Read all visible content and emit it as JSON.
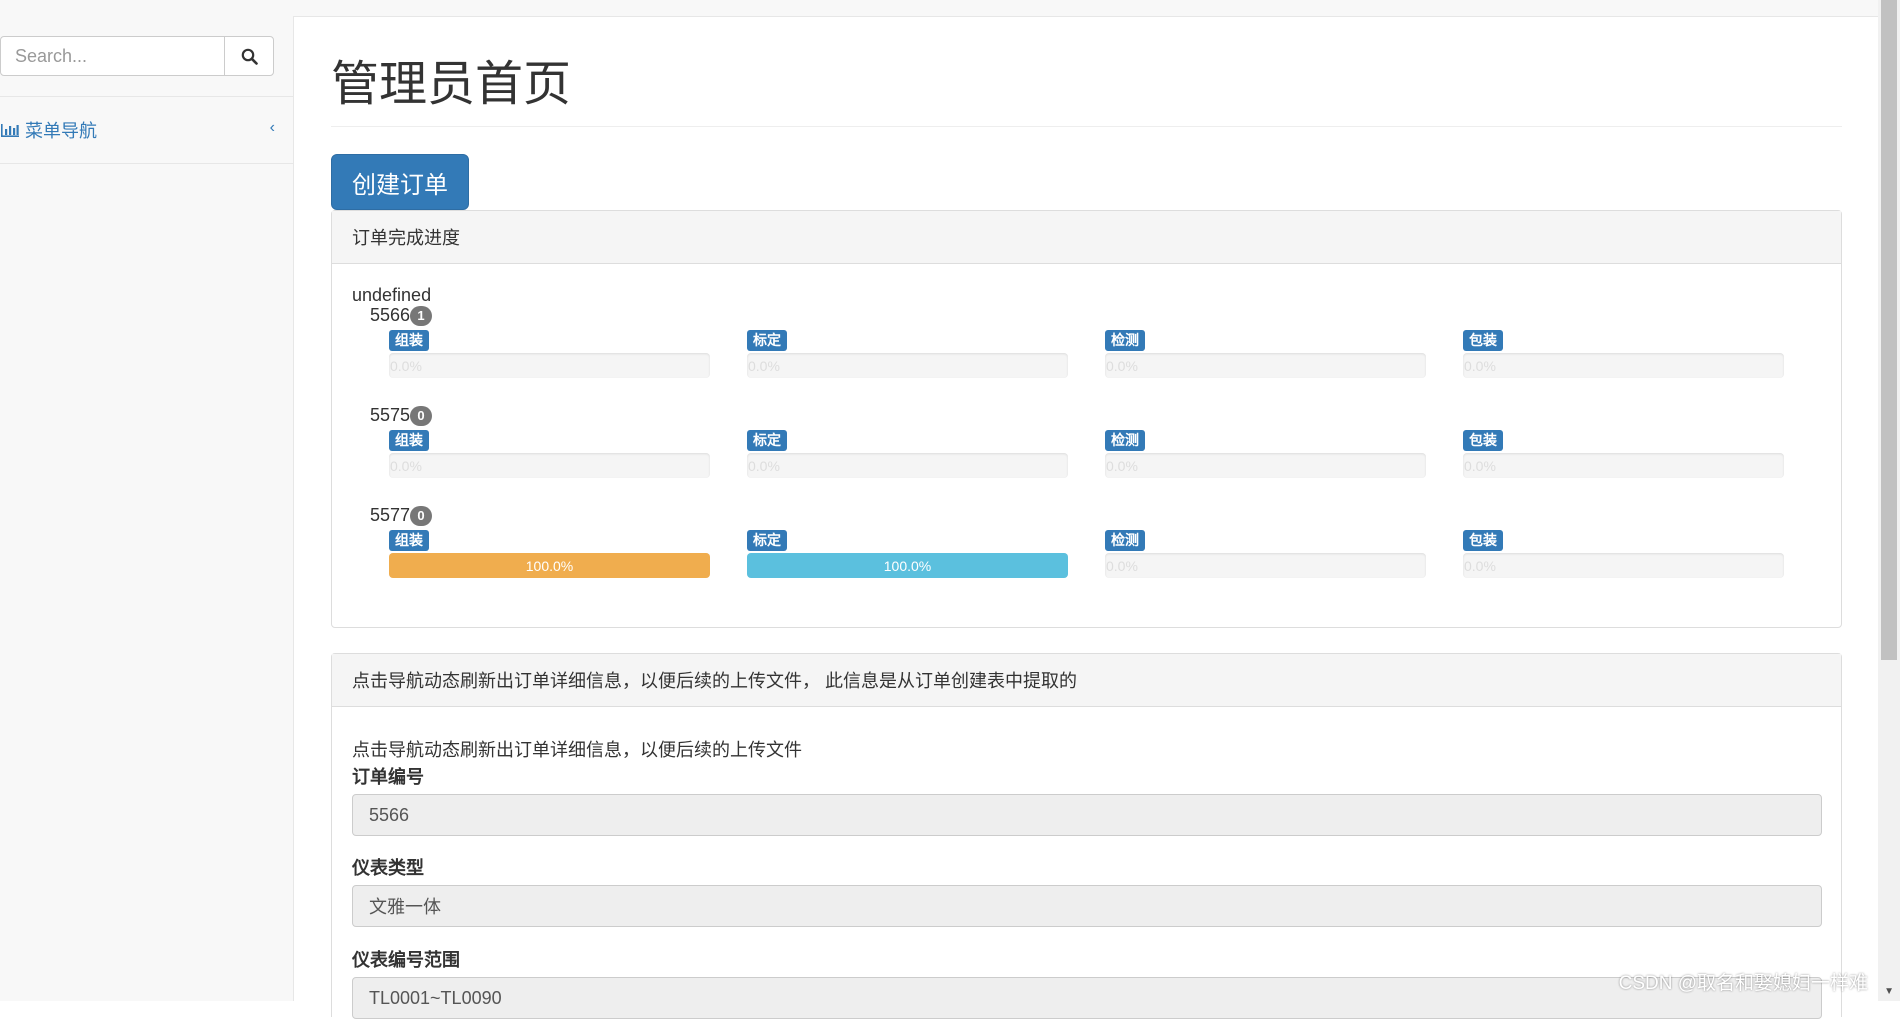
{
  "search": {
    "placeholder": "Search..."
  },
  "sidebar": {
    "nav_label": "菜单导航",
    "chevron": "‹"
  },
  "page": {
    "title": "管理员首页"
  },
  "actions": {
    "create_order": "创建订单"
  },
  "progress_panel": {
    "heading": "订单完成进度",
    "group_label": "undefined",
    "stage_names": [
      "组装",
      "标定",
      "检测",
      "包装"
    ],
    "orders": [
      {
        "number": "5566",
        "badge": "1",
        "stages": [
          {
            "name": "组装",
            "text": "0.0%",
            "percent": 0
          },
          {
            "name": "标定",
            "text": "0.0%",
            "percent": 0
          },
          {
            "name": "检测",
            "text": "0.0%",
            "percent": 0
          },
          {
            "name": "包装",
            "text": "0.0%",
            "percent": 0
          }
        ]
      },
      {
        "number": "5575",
        "badge": "0",
        "stages": [
          {
            "name": "组装",
            "text": "0.0%",
            "percent": 0
          },
          {
            "name": "标定",
            "text": "0.0%",
            "percent": 0
          },
          {
            "name": "检测",
            "text": "0.0%",
            "percent": 0
          },
          {
            "name": "包装",
            "text": "0.0%",
            "percent": 0
          }
        ]
      },
      {
        "number": "5577",
        "badge": "0",
        "stages": [
          {
            "name": "组装",
            "text": "100.0%",
            "percent": 100,
            "color": "#f0ad4e"
          },
          {
            "name": "标定",
            "text": "100.0%",
            "percent": 100,
            "color": "#5bc0de"
          },
          {
            "name": "检测",
            "text": "0.0%",
            "percent": 0
          },
          {
            "name": "包装",
            "text": "0.0%",
            "percent": 0
          }
        ]
      }
    ]
  },
  "detail_panel": {
    "heading": "点击导航动态刷新出订单详细信息，以便后续的上传文件， 此信息是从订单创建表中提取的",
    "intro": "点击导航动态刷新出订单详细信息，以便后续的上传文件",
    "fields": [
      {
        "label": "订单编号",
        "value": "5566"
      },
      {
        "label": "仪表类型",
        "value": "文雅一体"
      },
      {
        "label": "仪表编号范围",
        "value": "TL0001~TL0090"
      }
    ]
  },
  "watermark": "CSDN @取名和娶媳妇一样难",
  "colors": {
    "primary": "#337ab7",
    "warning": "#f0ad4e",
    "info": "#5bc0de",
    "badge": "#777777"
  }
}
